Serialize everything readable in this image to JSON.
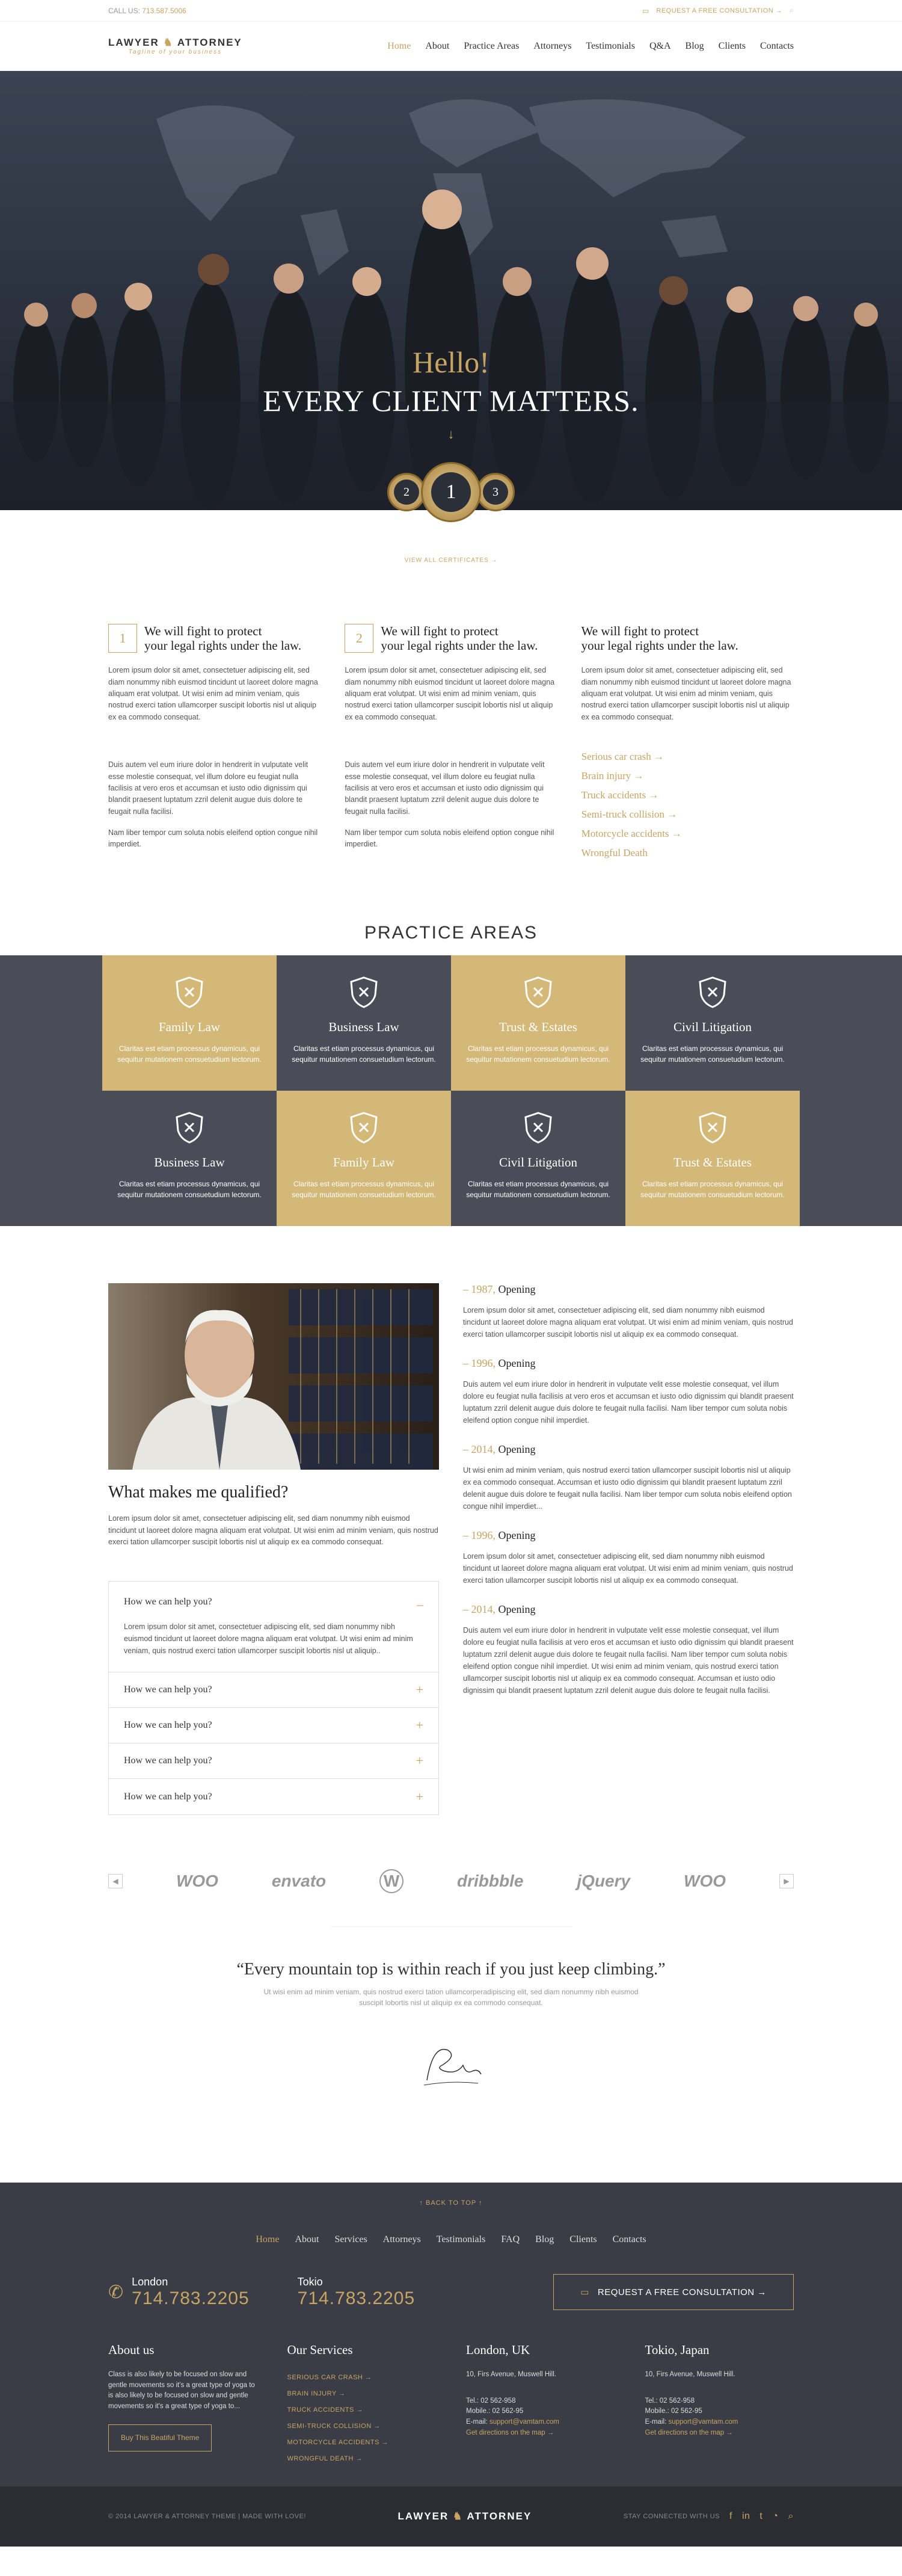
{
  "topbar": {
    "call_label": "CALL US:",
    "phone": "713.587.5006",
    "cta": "REQUEST A FREE CONSULTATION →"
  },
  "logo": {
    "left": "LAWYER",
    "right": "ATTORNEY",
    "tagline": "Tagline of your business"
  },
  "nav": [
    "Home",
    "About",
    "Practice Areas",
    "Attorneys",
    "Testimonials",
    "Q&A",
    "Blog",
    "Clients",
    "Contacts"
  ],
  "hero": {
    "hello": "Hello!",
    "headline": "EVERY CLIENT MATTERS.",
    "arrow": "↓"
  },
  "badges": [
    "2",
    "1",
    "3"
  ],
  "view_cert": "VIEW ALL CERTIFICATES →",
  "columns": [
    {
      "num": "1",
      "title_1": "We will fight to protect",
      "title_2": "your legal rights under the law.",
      "p1": "Lorem ipsum dolor sit amet, consectetuer adipiscing elit, sed diam nonummy nibh euismod tincidunt ut laoreet dolore magna aliquam erat volutpat. Ut wisi enim ad minim veniam, quis nostrud exerci tation ullamcorper suscipit lobortis nisl ut aliquip ex ea commodo consequat.",
      "p2": "Duis autem vel eum iriure dolor in hendrerit in vulputate velit esse molestie consequat, vel illum dolore eu feugiat nulla facilisis at vero eros et accumsan et iusto odio dignissim qui blandit praesent luptatum zzril delenit augue duis dolore te feugait nulla facilisi.",
      "p3": "Nam liber tempor cum soluta nobis eleifend option congue nihil imperdiet."
    },
    {
      "num": "2",
      "title_1": "We will fight to protect",
      "title_2": "your legal rights under the law.",
      "p1": "Lorem ipsum dolor sit amet, consectetuer adipiscing elit, sed diam nonummy nibh euismod tincidunt ut laoreet dolore magna aliquam erat volutpat. Ut wisi enim ad minim veniam, quis nostrud exerci tation ullamcorper suscipit lobortis nisl ut aliquip ex ea commodo consequat.",
      "p2": "Duis autem vel eum iriure dolor in hendrerit in vulputate velit esse molestie consequat, vel illum dolore eu feugiat nulla facilisis at vero eros et accumsan et iusto odio dignissim qui blandit praesent luptatum zzril delenit augue duis dolore te feugait nulla facilisi.",
      "p3": "Nam liber tempor cum soluta nobis eleifend option congue nihil imperdiet."
    },
    {
      "title_1": "We will fight to protect",
      "title_2": "your legal rights under the law.",
      "p1": "Lorem ipsum dolor sit amet, consectetuer adipiscing elit, sed diam nonummy nibh euismod tincidunt ut laoreet dolore magna aliquam erat volutpat. Ut wisi enim ad minim veniam, quis nostrud exerci tation ullamcorper suscipit lobortis nisl ut aliquip ex ea commodo consequat.",
      "links": [
        "Serious car crash →",
        "Brain injury →",
        "Truck accidents →",
        "Semi-truck collision →",
        "Motorcycle accidents →",
        "Wrongful Death"
      ]
    }
  ],
  "practice": {
    "title": "PRACTICE AREAS",
    "desc": "Claritas est etiam processus dynamicus, qui sequitur mutationem consuetudium lectorum.",
    "cells": [
      "Family Law",
      "Business Law",
      "Trust & Estates",
      "Civil Litigation",
      "Business Law",
      "Family Law",
      "Civil Litigation",
      "Trust & Estates"
    ]
  },
  "qualified": {
    "title": "What makes me qualified?",
    "text": "Lorem ipsum dolor sit amet, consectetuer adipiscing elit, sed diam nonummy nibh euismod tincidunt ut laoreet dolore magna aliquam erat volutpat. Ut wisi enim ad minim veniam, quis nostrud exerci tation ullamcorper suscipit lobortis nisl ut aliquip ex ea commodo consequat.",
    "acc_open_title": "How we can help you?",
    "acc_open_text": "Lorem ipsum dolor sit amet, consectetuer adipiscing elit, sed diam nonummy nibh euismod tincidunt ut laoreet dolore magna aliquam erat volutpat. Ut wisi enim ad minim veniam, quis nostrud exerci tation ullamcorper suscipit lobortis nisl ut aliquip..",
    "acc_items": [
      "How we can help you?",
      "How we can help you?",
      "How we can help you?",
      "How we can help you?"
    ],
    "timeline": [
      {
        "year": "– 1987,",
        "label": "Opening",
        "text": "Lorem ipsum dolor sit amet, consectetuer adipiscing elit, sed diam nonummy nibh euismod tincidunt ut laoreet dolore magna aliquam erat volutpat. Ut wisi enim ad minim veniam, quis nostrud exerci tation ullamcorper suscipit lobortis nisl ut aliquip ex ea commodo consequat."
      },
      {
        "year": "– 1996,",
        "label": "Opening",
        "text": "Duis autem vel eum iriure dolor in hendrerit in vulputate velit esse molestie consequat, vel illum dolore eu feugiat nulla facilisis at vero eros et accumsan et iusto odio dignissim qui blandit praesent luptatum zzril delenit augue duis dolore te feugait nulla facilisi. Nam liber tempor cum soluta nobis eleifend option congue nihil imperdiet."
      },
      {
        "year": "– 2014,",
        "label": "Opening",
        "text": "Ut wisi enim ad minim veniam, quis nostrud exerci tation ullamcorper suscipit lobortis nisl ut aliquip ex ea commodo consequat. Accumsan et iusto odio dignissim qui blandit praesent luptatum zzril delenit augue duis dolore te feugait nulla facilisi. Nam liber tempor cum soluta nobis eleifend option congue nihil imperdiet..."
      },
      {
        "year": "– 1996,",
        "label": "Opening",
        "text": "Lorem ipsum dolor sit amet, consectetuer adipiscing elit, sed diam nonummy nibh euismod tincidunt ut laoreet dolore magna aliquam erat volutpat. Ut wisi enim ad minim veniam, quis nostrud exerci tation ullamcorper suscipit lobortis nisl ut aliquip ex ea commodo consequat."
      },
      {
        "year": "– 2014,",
        "label": "Opening",
        "text": "Duis autem vel eum iriure dolor in hendrerit in vulputate velit esse molestie consequat, vel illum dolore eu feugiat nulla facilisis at vero eros et accumsan et iusto odio dignissim qui blandit praesent luptatum zzril delenit augue duis dolore te feugait nulla facilisi. Nam liber tempor cum soluta nobis eleifend option congue nihil imperdiet. Ut wisi enim ad minim veniam, quis nostrud exerci tation ullamcorper suscipit lobortis nisl ut aliquip ex ea commodo consequat. Accumsan et iusto odio dignissim qui blandit praesent luptatum zzril delenit augue duis dolore te feugait nulla facilisi."
      }
    ]
  },
  "logos": [
    "WOO",
    "envato",
    "W",
    "dribbble",
    "jQuery",
    "WOO"
  ],
  "quote": {
    "text": "“Every mountain top is within reach if you just keep climbing.”",
    "sub": "Ut wisi enim ad minim veniam, quis nostrud exerci tation ullamcorperadipiscing elit, sed diam nonummy nibh euismod suscipit lobortis nisl ut aliquip ex ea commodo consequat."
  },
  "footer": {
    "back_to_top": "↑ BACK TO TOP ↑",
    "nav": [
      "Home",
      "About",
      "Services",
      "Attorneys",
      "Testimonials",
      "FAQ",
      "Blog",
      "Clients",
      "Contacts"
    ],
    "london_city": "London",
    "london_phone": "714.783.2205",
    "tokio_city": "Tokio",
    "tokio_phone": "714.783.2205",
    "consult": "REQUEST A FREE CONSULTATION →",
    "about_title": "About us",
    "about_text": "Class is also likely to be focused on slow and gentle movements so it's a great type of yoga to is also likely to be focused on slow and gentle movements so it's a great type of yoga to...",
    "about_btn": "Buy This Beatiful Theme",
    "services_title": "Our Services",
    "services": [
      "SERIOUS CAR CRASH →",
      "BRAIN INJURY →",
      "TRUCK ACCIDENTS →",
      "SEMI-TRUCK COLLISION →",
      "MOTORCYCLE ACCIDENTS →",
      "WRONGFUL DEATH →"
    ],
    "uk_title": "London, UK",
    "uk_addr": "10, Firs Avenue, Muswell Hill.",
    "uk_tel": "Tel.: 02 562-958",
    "uk_mob": "Mobile.: 02 562-95",
    "uk_email_label": "E-mail:",
    "uk_email": "support@vamtam.com",
    "uk_dir": "Get directions on the map →",
    "jp_title": "Tokio, Japan",
    "jp_addr": "10, Firs Avenue, Muswell Hill.",
    "jp_tel": "Tel.: 02 562-958",
    "jp_mob": "Mobile.: 02 562-95",
    "jp_email_label": "E-mail:",
    "jp_email": "support@vamtam.com",
    "jp_dir": "Get directions on the map →"
  },
  "bottom": {
    "copyright": "© 2014 LAWYER & ATTORNEY THEME | MADE WITH LOVE!",
    "stay": "STAY CONNECTED WITH US"
  },
  "icons": {
    "phone": "phone-icon",
    "chat": "chat-icon",
    "search": "search-icon",
    "facebook": "facebook-icon",
    "linkedin": "linkedin-icon",
    "twitter": "twitter-icon",
    "rss": "rss-icon"
  },
  "colors": {
    "gold": "#c8a464",
    "dark": "#4a4d57",
    "footer": "#3a3d45"
  }
}
